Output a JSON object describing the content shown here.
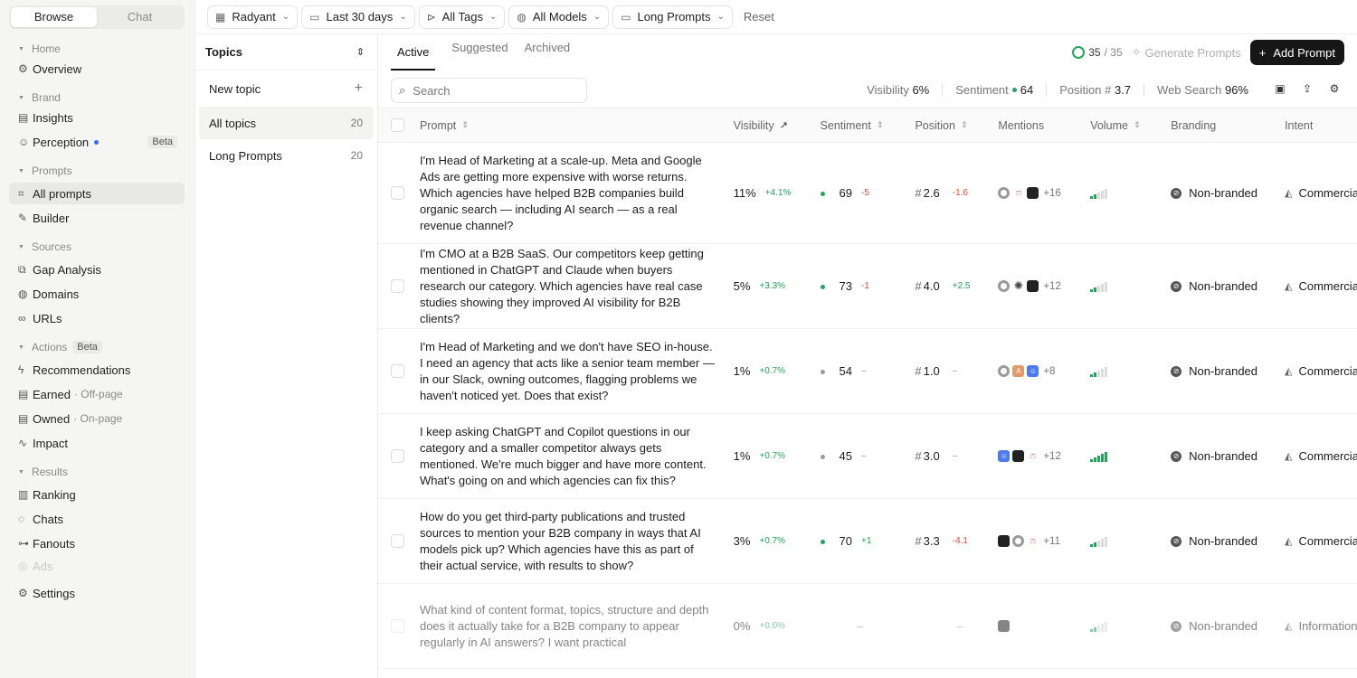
{
  "sidebar": {
    "mode_tabs": [
      "Browse",
      "Chat"
    ],
    "sections": [
      {
        "label": "Home",
        "items": [
          {
            "label": "Overview",
            "icon": "sliders-icon"
          }
        ]
      },
      {
        "label": "Brand",
        "items": [
          {
            "label": "Insights",
            "icon": "document-icon"
          },
          {
            "label": "Perception",
            "icon": "smiley-icon",
            "badge": "Beta"
          }
        ]
      },
      {
        "label": "Prompts",
        "items": [
          {
            "label": "All prompts",
            "icon": "scan-icon"
          },
          {
            "label": "Builder",
            "icon": "wand-icon"
          }
        ]
      },
      {
        "label": "Sources",
        "items": [
          {
            "label": "Gap Analysis",
            "icon": "gap-icon"
          },
          {
            "label": "Domains",
            "icon": "globe-icon"
          },
          {
            "label": "URLs",
            "icon": "link-icon"
          }
        ]
      },
      {
        "label": "Actions",
        "badge": "Beta",
        "items": [
          {
            "label": "Recommendations",
            "icon": "bolt-icon"
          },
          {
            "label": "Earned",
            "sub": "· Off-page",
            "icon": "document-icon"
          },
          {
            "label": "Owned",
            "sub": "· On-page",
            "icon": "document-icon"
          },
          {
            "label": "Impact",
            "icon": "pulse-icon"
          }
        ]
      },
      {
        "label": "Results",
        "items": [
          {
            "label": "Ranking",
            "icon": "bar-chart-icon"
          },
          {
            "label": "Chats",
            "icon": "chat-icon"
          },
          {
            "label": "Fanouts",
            "icon": "fanout-icon"
          },
          {
            "label": "Ads",
            "icon": "ads-icon"
          }
        ]
      }
    ],
    "settings": "Settings"
  },
  "filters": {
    "brand": "Radyant",
    "date": "Last 30 days",
    "tags": "All Tags",
    "models": "All Models",
    "folder": "Long Prompts",
    "reset": "Reset"
  },
  "topics": {
    "header": "Topics",
    "new_topic": "New topic",
    "rows": [
      {
        "label": "All topics",
        "count": "20"
      },
      {
        "label": "Long Prompts",
        "count": "20"
      }
    ]
  },
  "tabs": [
    "Active",
    "Suggested",
    "Archived"
  ],
  "toolbar": {
    "count_done": "35",
    "count_total": "/ 35",
    "generate": "Generate Prompts",
    "add": "Add Prompt",
    "search_placeholder": "Search"
  },
  "stats": {
    "visibility_label": "Visibility",
    "visibility": "6%",
    "sentiment_label": "Sentiment",
    "sentiment": "64",
    "position_label": "Position #",
    "position": "3.7",
    "web_label": "Web Search",
    "web": "96%"
  },
  "columns": {
    "prompt": "Prompt",
    "visibility": "Visibility",
    "sentiment": "Sentiment",
    "position": "Position",
    "mentions": "Mentions",
    "volume": "Volume",
    "branding": "Branding",
    "intent": "Intent"
  },
  "rows": [
    {
      "prompt": "I'm Head of Marketing at a scale-up. Meta and Google Ads are getting more expensive with worse returns. Which agencies have helped B2B companies build organic search — including AI search — as a real revenue channel?",
      "vis": "11%",
      "vis_ch": "+4.1%",
      "sent": "69",
      "sent_ch": "-5",
      "pos": "2.6",
      "pos_ch": "-1.6",
      "ment": "+16",
      "vol": 2,
      "brand": "Non-branded",
      "intent": "Commercial"
    },
    {
      "prompt": "I'm CMO at a B2B SaaS. Our competitors keep getting mentioned in ChatGPT and Claude when buyers research our category. Which agencies have real case studies showing they improved AI visibility for B2B clients?",
      "vis": "5%",
      "vis_ch": "+3.3%",
      "sent": "73",
      "sent_ch": "-1",
      "pos": "4.0",
      "pos_ch": "+2.5",
      "ment": "+12",
      "vol": 2,
      "brand": "Non-branded",
      "intent": "Commercial"
    },
    {
      "prompt": "I'm Head of Marketing and we don't have SEO in-house. I need an agency that acts like a senior team member — in our Slack, owning outcomes, flagging problems we haven't noticed yet. Does that exist?",
      "vis": "1%",
      "vis_ch": "+0.7%",
      "sent": "54",
      "sent_ch": "–",
      "pos": "1.0",
      "pos_ch": "–",
      "ment": "+8",
      "vol": 2,
      "brand": "Non-branded",
      "intent": "Commercial"
    },
    {
      "prompt": "I keep asking ChatGPT and Copilot questions in our category and a smaller competitor always gets mentioned. We're much bigger and have more content. What's going on and which agencies can fix this?",
      "vis": "1%",
      "vis_ch": "+0.7%",
      "sent": "45",
      "sent_ch": "–",
      "pos": "3.0",
      "pos_ch": "–",
      "ment": "+12",
      "vol": 5,
      "brand": "Non-branded",
      "intent": "Commercial"
    },
    {
      "prompt": "How do you get third-party publications and trusted sources to mention your B2B company in ways that AI models pick up? Which agencies have this as part of their actual service, with results to show?",
      "vis": "3%",
      "vis_ch": "+0.7%",
      "sent": "70",
      "sent_ch": "+1",
      "pos": "3.3",
      "pos_ch": "-4.1",
      "ment": "+11",
      "vol": 2,
      "brand": "Non-branded",
      "intent": "Commercial"
    },
    {
      "prompt": "What kind of content format, topics, structure and depth does it actually take for a B2B company to appear regularly in AI answers? I want practical",
      "vis": "0%",
      "vis_ch": "+0.0%",
      "sent": "–",
      "sent_ch": "",
      "pos": "–",
      "pos_ch": "",
      "ment": "",
      "vol": 2,
      "brand": "Non-branded",
      "intent": "Informational"
    }
  ]
}
